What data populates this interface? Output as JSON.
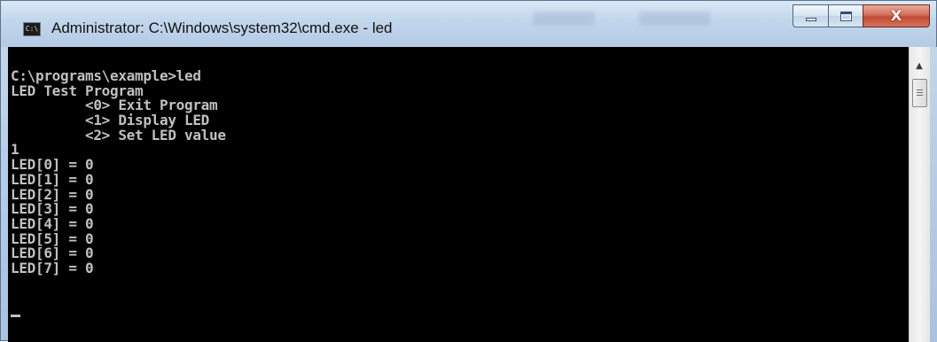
{
  "window": {
    "title": "Administrator: C:\\Windows\\system32\\cmd.exe - led",
    "icon_text": "C:\\",
    "icon": "cmd-console-icon"
  },
  "caption_buttons": {
    "minimize": "minimize-icon",
    "maximize": "maximize-icon",
    "close": "close-icon",
    "close_glyph": "X"
  },
  "console": {
    "lines": [
      "C:\\programs\\example>led",
      "LED Test Program",
      "         <0> Exit Program",
      "         <1> Display LED",
      "         <2> Set LED value",
      "1",
      "LED[0] = 0",
      "LED[1] = 0",
      "LED[2] = 0",
      "LED[3] = 0",
      "LED[4] = 0",
      "LED[5] = 0",
      "LED[6] = 0",
      "LED[7] = 0"
    ],
    "colors": {
      "background": "#000000",
      "text": "#c0c0c0"
    }
  },
  "scrollbar": {
    "up_arrow": "scroll-up-arrow-icon",
    "up_glyph": "▲"
  }
}
